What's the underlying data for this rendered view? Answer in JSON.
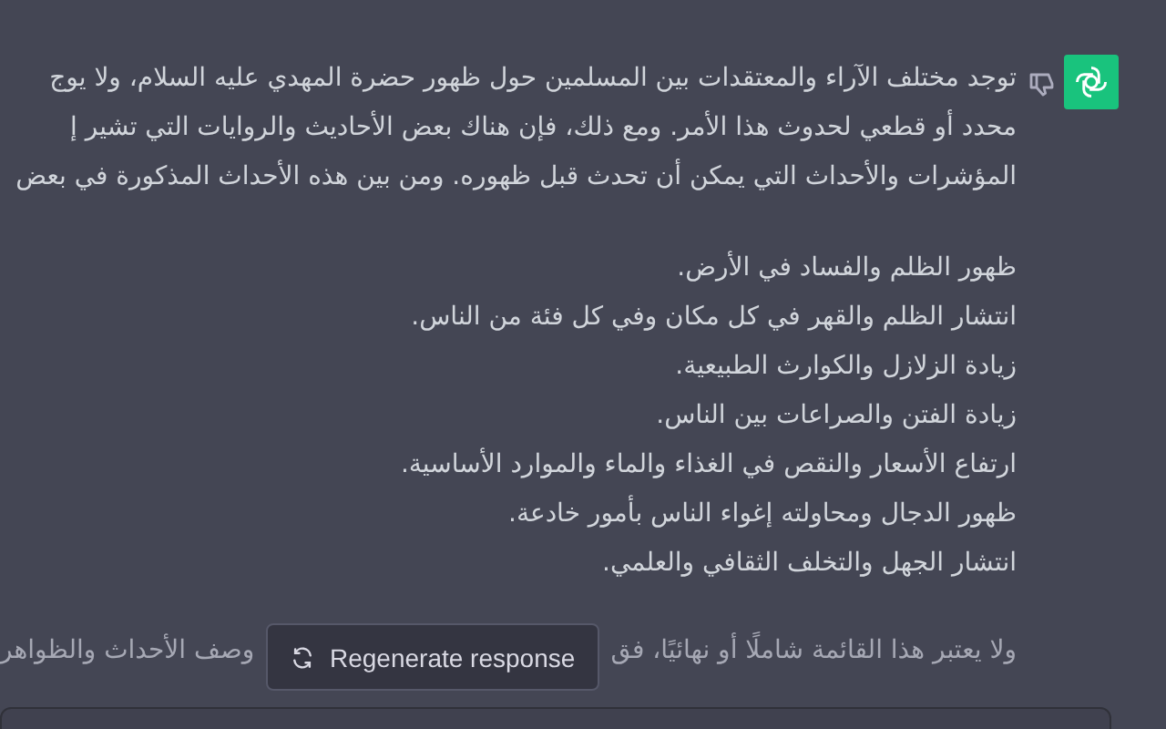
{
  "message": {
    "intro_lines": [
      "توجد مختلف الآراء والمعتقدات بين المسلمين حول ظهور حضرة المهدي عليه السلام، ولا يوج",
      "محدد أو قطعي لحدوث هذا الأمر. ومع ذلك، فإن هناك بعض الأحاديث والروايات التي تشير إ",
      "المؤشرات والأحداث التي يمكن أن تحدث قبل ظهوره. ومن بين هذه الأحداث المذكورة في بعض"
    ],
    "list_items": [
      "ظهور الظلم والفساد في الأرض.",
      "انتشار الظلم والقهر في كل مكان وفي كل فئة من الناس.",
      "زيادة الزلازل والكوارث الطبيعية.",
      "زيادة الفتن والصراعات بين الناس.",
      "ارتفاع الأسعار والنقص في الغذاء والماء والموارد الأساسية.",
      "ظهور الدجال ومحاولته إغواء الناس بأمور خادعة.",
      "انتشار الجهل والتخلف الثقافي والعلمي."
    ],
    "closing_line": {
      "right_part": "ولا يعتبر هذا القائمة شاملًا أو نهائيًا، فق",
      "left_part": "وصف الأحداث والظواهر"
    }
  },
  "regenerate_button": {
    "label": "Regenerate response"
  }
}
